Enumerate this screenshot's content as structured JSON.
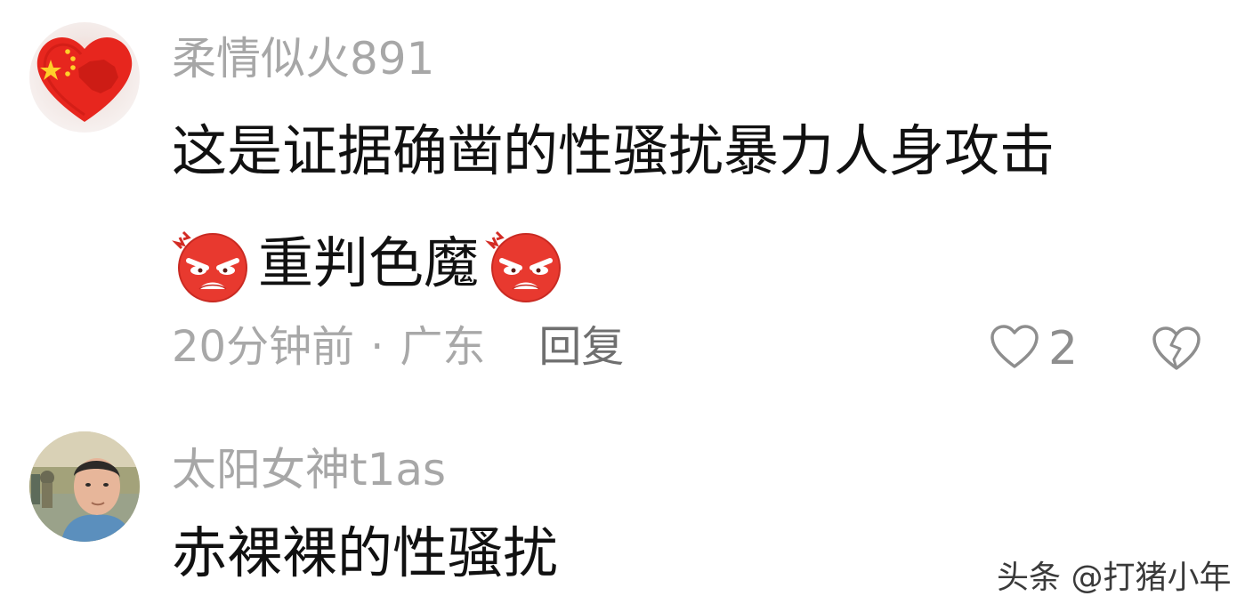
{
  "comments": [
    {
      "username": "柔情似火891",
      "text_line_1": "这是证据确凿的性骚扰暴力人身攻击",
      "text_line_2": "重判色魔",
      "time": "20分钟前",
      "separator": "·",
      "location": "广东",
      "reply_label": "回复",
      "likes": "2",
      "avatar_icon": "china-flag-heart-avatar",
      "emoji_icon": "angry-face-emoji"
    },
    {
      "username": "太阳女神t1as",
      "text_line_1": "赤裸裸的性骚扰",
      "avatar_icon": "user-photo-avatar"
    }
  ],
  "icons": {
    "like": "heart-outline-icon",
    "dislike": "broken-heart-icon"
  },
  "colors": {
    "username": "#a7a7a7",
    "body_text": "#111111",
    "meta_text": "#a8a8a8",
    "reply_text": "#6f6f6f",
    "emoji_red": "#e8392f"
  },
  "watermark": "头条 @打猪小年"
}
